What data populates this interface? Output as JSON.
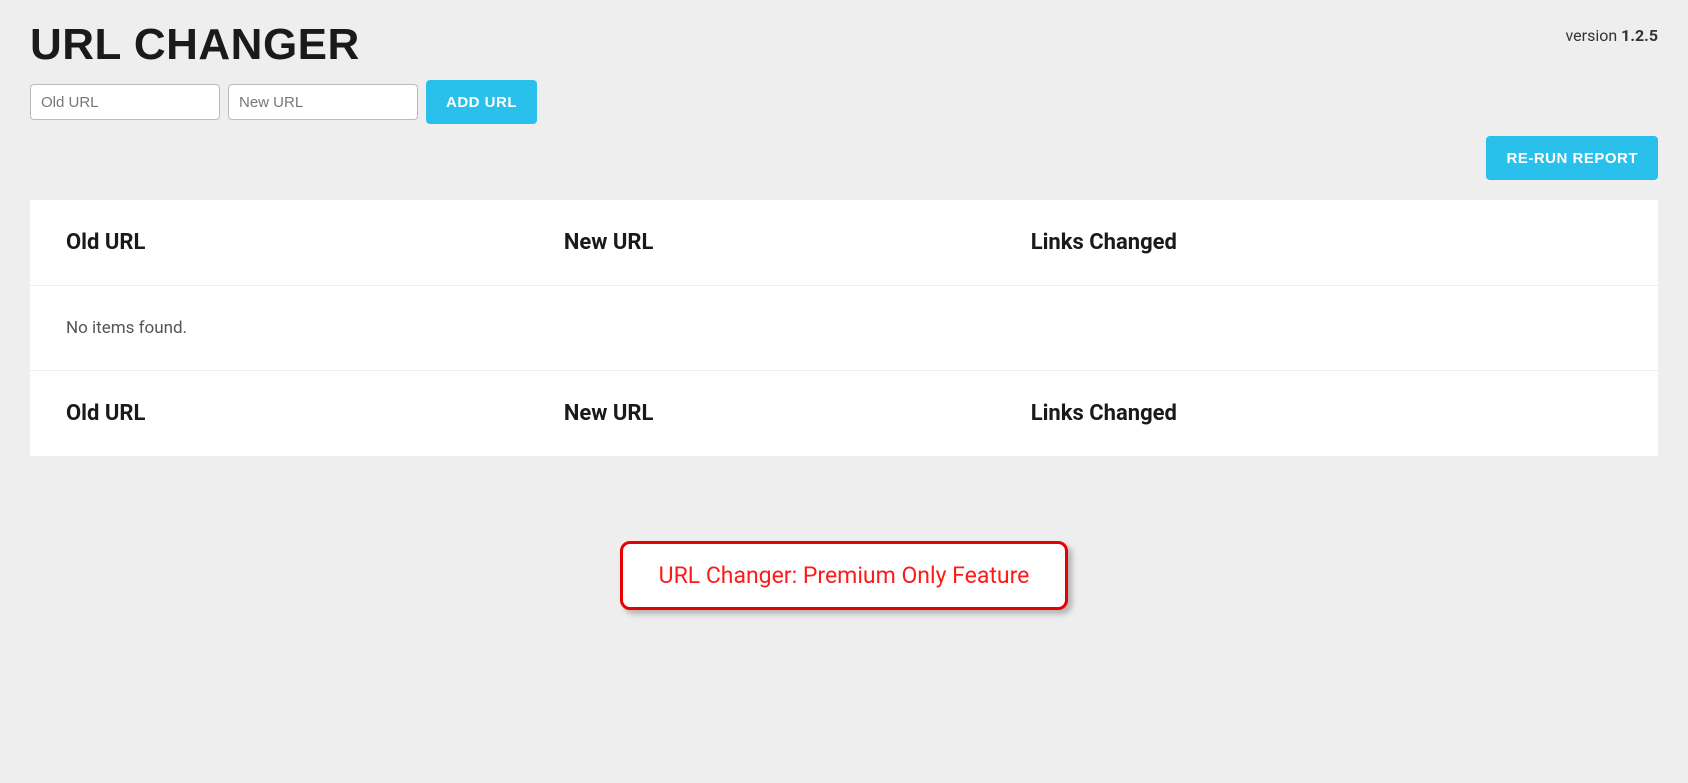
{
  "header": {
    "title": "URL CHANGER",
    "version_label": "version ",
    "version_number": "1.2.5"
  },
  "form": {
    "old_url_placeholder": "Old URL",
    "new_url_placeholder": "New URL",
    "add_button_label": "ADD URL",
    "rerun_button_label": "RE-RUN REPORT"
  },
  "table": {
    "headers": {
      "old": "Old URL",
      "new": "New URL",
      "links": "Links Changed"
    },
    "empty_message": "No items found.",
    "footers": {
      "old": "Old URL",
      "new": "New URL",
      "links": "Links Changed"
    }
  },
  "callout": {
    "text": "URL Changer: Premium Only Feature"
  }
}
